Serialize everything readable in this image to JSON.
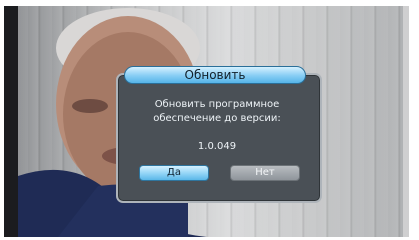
{
  "update_dialog": {
    "title": "Обновить",
    "message_line1": "Обновить программное",
    "message_line2": "обеспечение до версии:",
    "version": "1.0.049",
    "buttons": {
      "yes": "Да",
      "no": "Нет"
    }
  },
  "colors": {
    "dialog_bg": "#4a5056",
    "accent": "#56b4e8",
    "button_no": "#8f959b"
  }
}
